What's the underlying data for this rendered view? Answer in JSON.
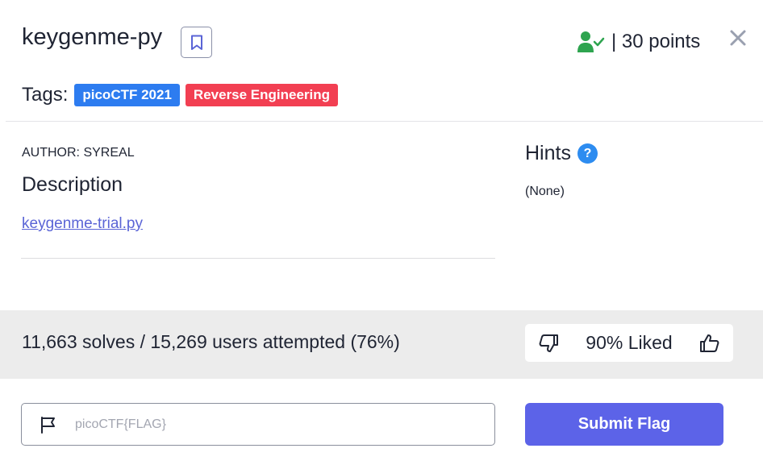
{
  "challenge": {
    "title": "keygenme-py",
    "points_text": "| 30 points"
  },
  "tags": {
    "label": "Tags:",
    "items": [
      {
        "name": "picoCTF 2021",
        "color": "#2d7cf0"
      },
      {
        "name": "Reverse Engineering",
        "color": "#f23f52"
      }
    ]
  },
  "details": {
    "author": "AUTHOR: SYREAL",
    "description_heading": "Description",
    "file_link": "keygenme-trial.py"
  },
  "hints": {
    "heading": "Hints",
    "help_glyph": "?",
    "value": "(None)"
  },
  "stats": {
    "solves_text": "11,663 solves / 15,269 users attempted (76%)",
    "liked_text": "90% Liked"
  },
  "flag_form": {
    "placeholder": "picoCTF{FLAG}",
    "submit_label": "Submit Flag"
  },
  "colors": {
    "solved_green": "#2ea44f",
    "accent": "#5c63e8",
    "link": "#5a64d6"
  }
}
